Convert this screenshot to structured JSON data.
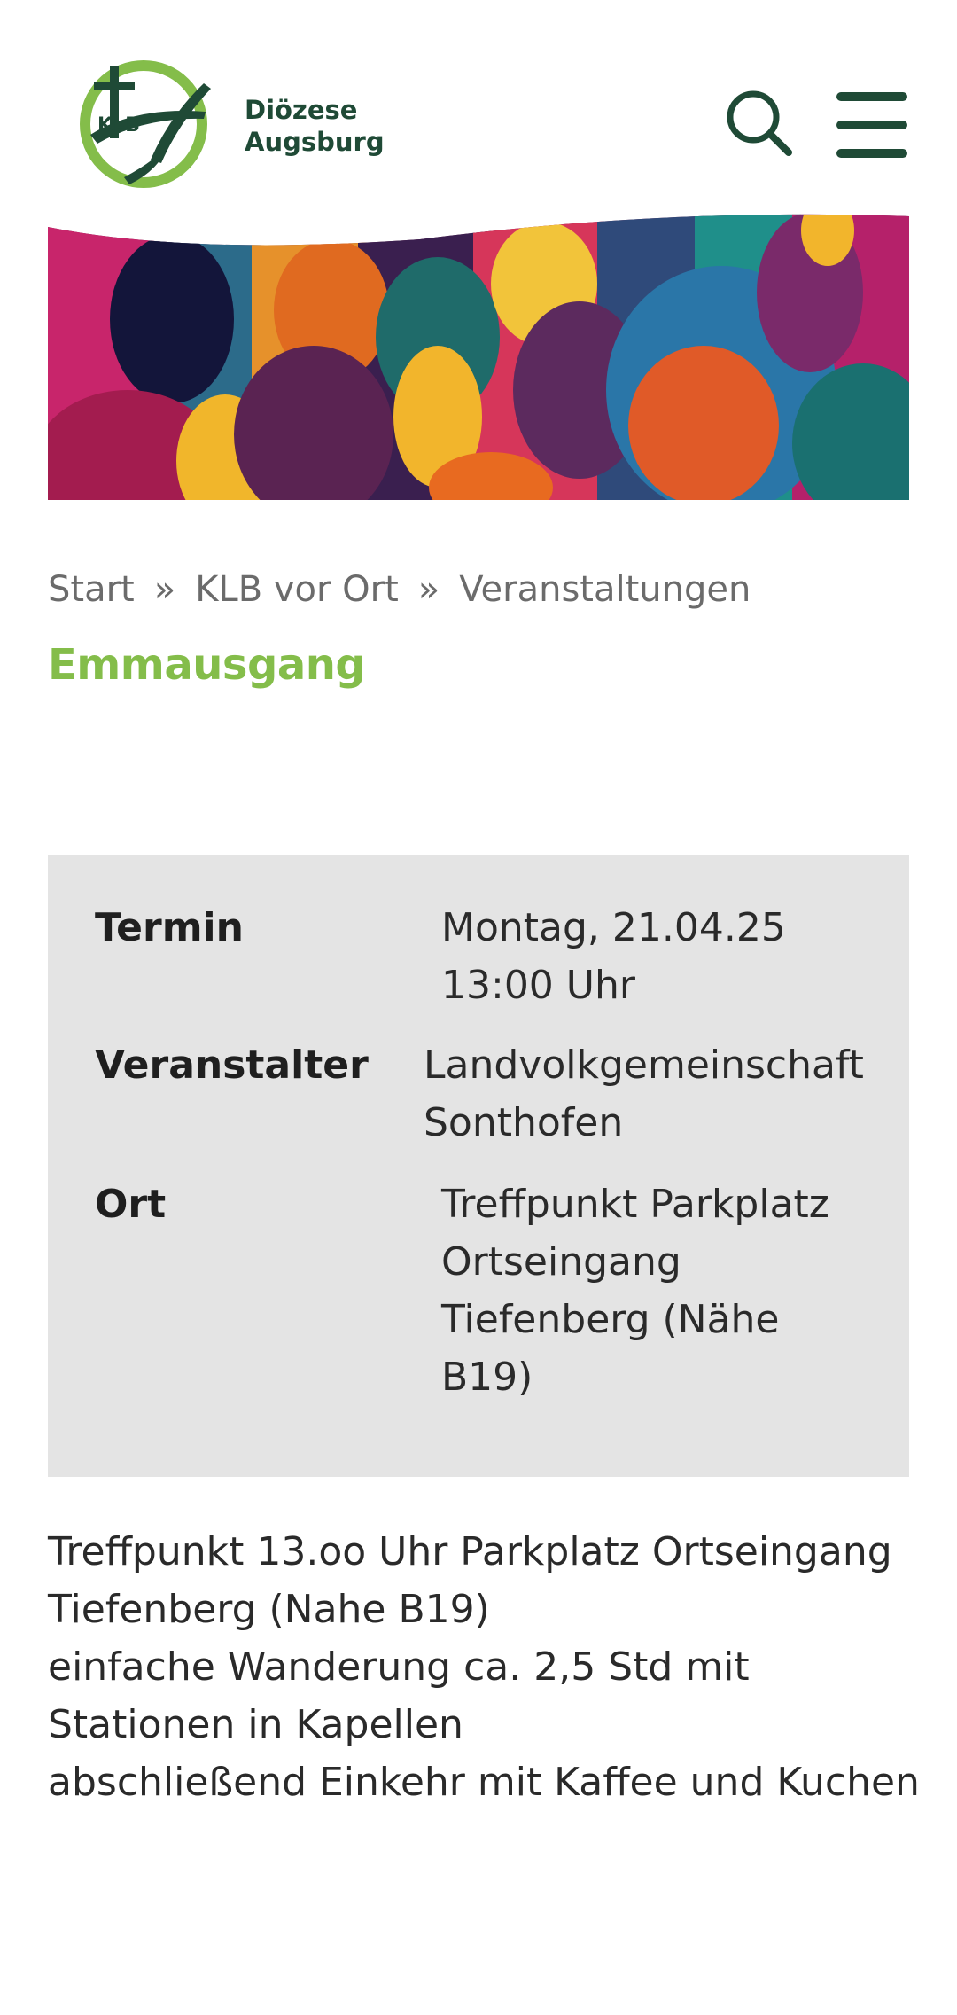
{
  "header": {
    "logo_badge": "KLB",
    "logo_line1": "Diözese",
    "logo_line2": "Augsburg",
    "search_icon": "search-icon",
    "menu_icon": "hamburger-menu-icon"
  },
  "colors": {
    "brand_dark_green": "#1f4a36",
    "brand_light_green": "#84bd4a",
    "info_box_bg": "#e4e4e4",
    "breadcrumb_gray": "#6b6b6b"
  },
  "breadcrumb": {
    "items": [
      "Start",
      "KLB vor Ort",
      "Veranstaltungen"
    ],
    "separator": "»"
  },
  "page": {
    "title": "Emmausgang"
  },
  "event": {
    "termin_label": "Termin",
    "termin_value": "Montag, 21.04.25\n13:00 Uhr",
    "veranstalter_label": "Veranstalter",
    "veranstalter_value": "Landvolkgemeinschaft\nSonthofen",
    "ort_label": "Ort",
    "ort_value": "Treffpunkt Parkplatz\nOrtseingang\nTiefenberg (Nähe\nB19)"
  },
  "description": {
    "lines": [
      "Treffpunkt 13.oo Uhr Parkplatz Ortseingang Tiefenberg (Nahe B19)",
      "einfache Wanderung ca. 2,5 Std mit Stationen in Kapellen",
      "abschließend Einkehr mit Kaffee und Kuchen"
    ]
  }
}
